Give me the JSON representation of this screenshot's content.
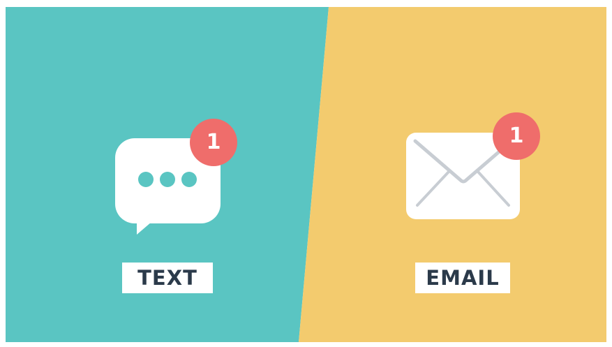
{
  "colors": {
    "teal_panel": "#5ac5c2",
    "yellow_panel": "#f3cb6e",
    "badge_red": "#ef6d6b",
    "icon_white": "#ffffff",
    "envelope_line": "#c8cdd3",
    "label_text": "#2b3a4a"
  },
  "text_panel": {
    "icon": "chat-bubble-icon",
    "badge_count": "1",
    "label": "TEXT"
  },
  "email_panel": {
    "icon": "envelope-icon",
    "badge_count": "1",
    "label": "EMAIL"
  }
}
